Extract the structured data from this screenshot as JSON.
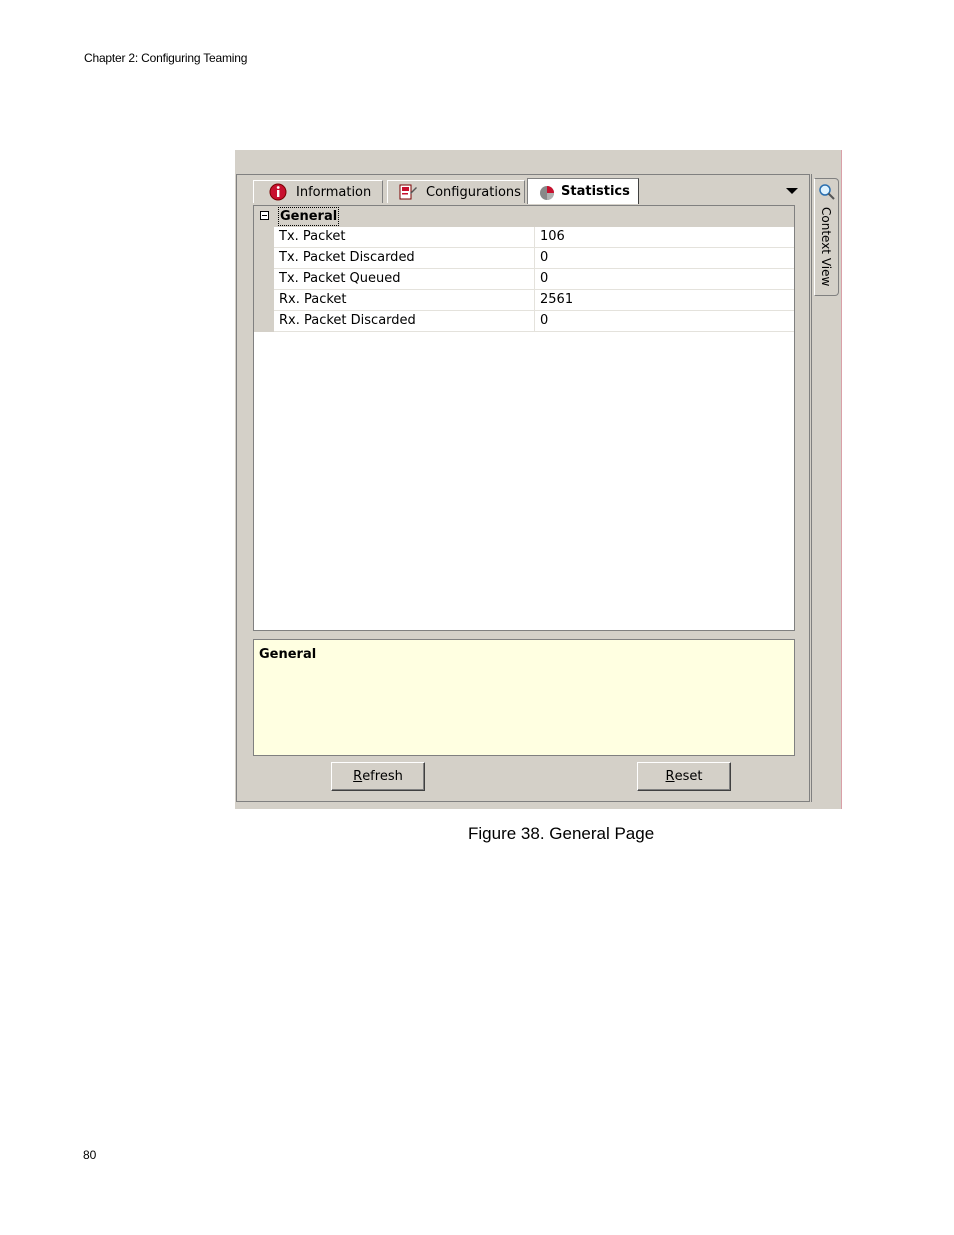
{
  "page": {
    "header": "Chapter 2: Configuring Teaming",
    "caption": "Figure 38. General Page",
    "page_number": "80"
  },
  "tabs": [
    {
      "label": "Information",
      "icon": "information-icon"
    },
    {
      "label": "Configurations",
      "icon": "configurations-icon"
    },
    {
      "label": "Statistics",
      "icon": "statistics-icon",
      "selected": true
    }
  ],
  "grid": {
    "category": "General",
    "rows": [
      {
        "name": "Tx. Packet",
        "value": "106"
      },
      {
        "name": "Tx. Packet Discarded",
        "value": "0"
      },
      {
        "name": "Tx. Packet Queued",
        "value": "0"
      },
      {
        "name": "Rx. Packet",
        "value": "2561"
      },
      {
        "name": "Rx. Packet Discarded",
        "value": "0"
      }
    ]
  },
  "description": {
    "title": "General"
  },
  "buttons": {
    "refresh_first": "R",
    "refresh_rest": "efresh",
    "reset_first": "R",
    "reset_rest": "eset"
  },
  "side_tab": {
    "label": "Context View",
    "icon": "magnifier-icon"
  },
  "colors": {
    "panel": "#d4d0c8",
    "description_bg": "#ffffe1",
    "grid_bg": "#ffffff"
  }
}
